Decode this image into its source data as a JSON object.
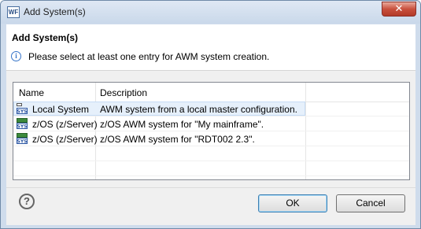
{
  "window": {
    "title": "Add System(s)",
    "app_icon_text": "WF",
    "close_glyph": "✕"
  },
  "header": {
    "title": "Add System(s)",
    "info_icon": "info-icon",
    "message": "Please select at least one entry for AWM system creation."
  },
  "table": {
    "columns": [
      "Name",
      "Description"
    ],
    "rows": [
      {
        "name": "Local System",
        "description": "AWM system from a local master configuration.",
        "icon": "system-icon",
        "selected": true
      },
      {
        "name": "z/OS (z/Server)",
        "description": "z/OS AWM system for \"My mainframe\".",
        "icon": "zos-system-icon",
        "selected": false
      },
      {
        "name": "z/OS (z/Server)",
        "description": "z/OS AWM system for \"RDT002 2.3\".",
        "icon": "zos-system-icon",
        "selected": false
      }
    ]
  },
  "footer": {
    "help_glyph": "?",
    "ok_label": "OK",
    "cancel_label": "Cancel"
  },
  "colors": {
    "selection": "#e6f0fb",
    "close_button": "#c9503d",
    "default_button_border": "#3c7fb1"
  }
}
